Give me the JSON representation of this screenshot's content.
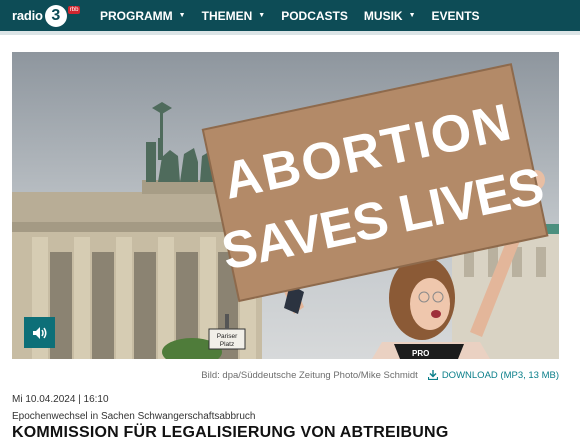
{
  "nav": {
    "logo_word": "radio",
    "logo_number": "3",
    "logo_badge": "rbb",
    "items": [
      {
        "label": "PROGRAMM",
        "dropdown": true
      },
      {
        "label": "THEMEN",
        "dropdown": true
      },
      {
        "label": "PODCASTS",
        "dropdown": false
      },
      {
        "label": "MUSIK",
        "dropdown": true
      },
      {
        "label": "EVENTS",
        "dropdown": false
      }
    ],
    "dropdown_glyph": "▼"
  },
  "hero": {
    "sign_line1": "ABORTION",
    "sign_line2": "SAVES LIVES",
    "shirt_text": "PRO",
    "street_sign_line1": "Pariser",
    "street_sign_line2": "Platz",
    "audio_icon": "speaker-icon"
  },
  "media": {
    "credit": "Bild: dpa/Süddeutsche Zeitung Photo/Mike Schmidt",
    "download_label": "DOWNLOAD (MP3, 13 MB)",
    "download_icon": "download-icon"
  },
  "article": {
    "date": "Mi 10.04.2024 | 16:10",
    "kicker": "Epochenwechsel in Sachen Schwangerschaftsabbruch",
    "headline": "KOMMISSION FÜR LEGALISIERUNG VON ABTREIBUNG"
  },
  "colors": {
    "nav_bg": "#0d4c56",
    "accent": "#0a7f8a",
    "audio_btn": "#0d6f78",
    "badge": "#d0262f"
  }
}
